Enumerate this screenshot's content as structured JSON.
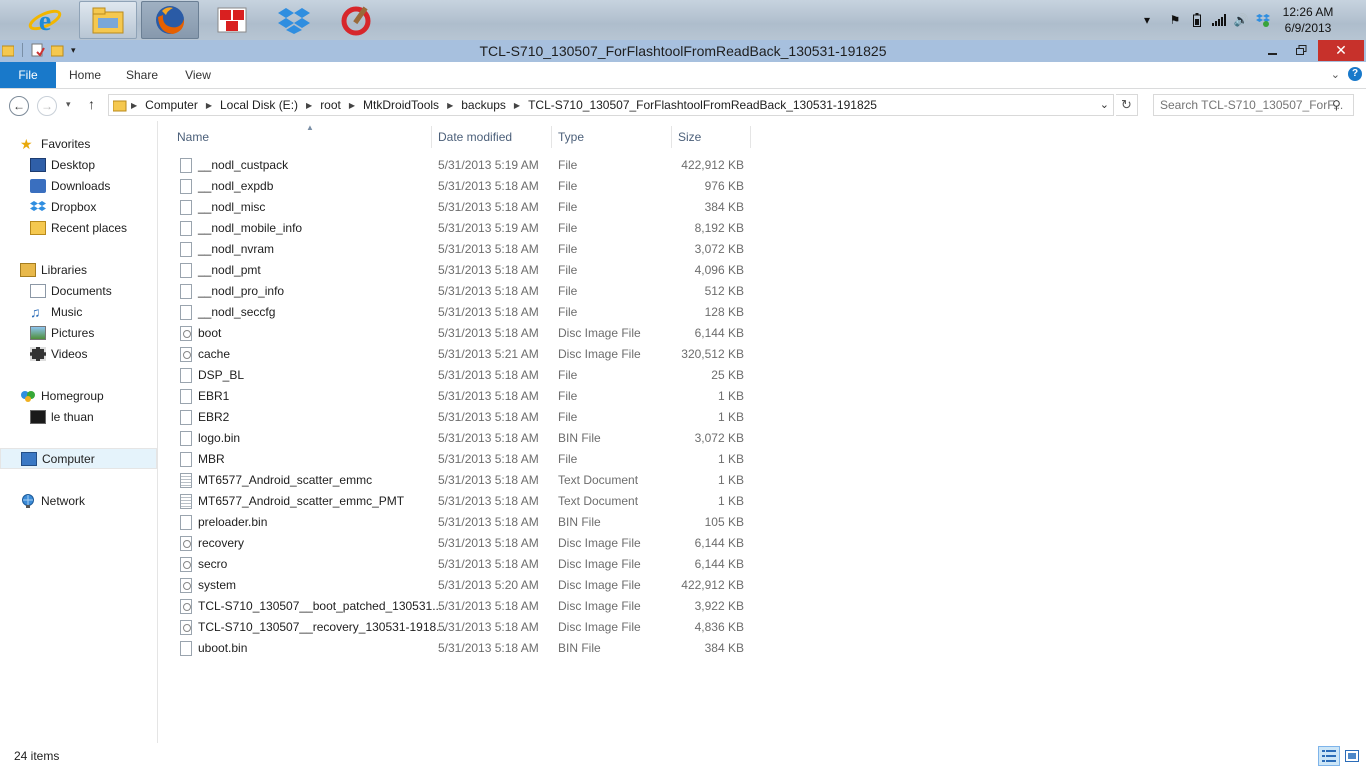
{
  "taskbar": {
    "apps": [
      {
        "name": "internet-explorer",
        "state": "normal"
      },
      {
        "name": "file-explorer",
        "state": "active"
      },
      {
        "name": "firefox",
        "state": "pressed"
      },
      {
        "name": "unikey",
        "state": "normal"
      },
      {
        "name": "dropbox",
        "state": "normal"
      },
      {
        "name": "ccleaner",
        "state": "normal"
      }
    ],
    "clock_time": "12:26 AM",
    "clock_date": "6/9/2013"
  },
  "window": {
    "title": "TCL-S710_130507_ForFlashtoolFromReadBack_130531-191825"
  },
  "ribbon": {
    "tabs": [
      "File",
      "Home",
      "Share",
      "View"
    ]
  },
  "address": {
    "crumbs": [
      "Computer",
      "Local Disk (E:)",
      "root",
      "MtkDroidTools",
      "backups",
      "TCL-S710_130507_ForFlashtoolFromReadBack_130531-191825"
    ],
    "search_placeholder": "Search TCL-S710_130507_ForF..."
  },
  "navpane": {
    "favorites": "Favorites",
    "fav_items": [
      "Desktop",
      "Downloads",
      "Dropbox",
      "Recent places"
    ],
    "libraries": "Libraries",
    "lib_items": [
      "Documents",
      "Music",
      "Pictures",
      "Videos"
    ],
    "homegroup": "Homegroup",
    "home_items": [
      "le thuan"
    ],
    "computer": "Computer",
    "network": "Network"
  },
  "columns": {
    "name": "Name",
    "date": "Date modified",
    "type": "Type",
    "size": "Size"
  },
  "files": [
    {
      "name": "__nodl_custpack",
      "date": "5/31/2013 5:19 AM",
      "type": "File",
      "size": "422,912 KB",
      "icon": "file"
    },
    {
      "name": "__nodl_expdb",
      "date": "5/31/2013 5:18 AM",
      "type": "File",
      "size": "976 KB",
      "icon": "file"
    },
    {
      "name": "__nodl_misc",
      "date": "5/31/2013 5:18 AM",
      "type": "File",
      "size": "384 KB",
      "icon": "file"
    },
    {
      "name": "__nodl_mobile_info",
      "date": "5/31/2013 5:19 AM",
      "type": "File",
      "size": "8,192 KB",
      "icon": "file"
    },
    {
      "name": "__nodl_nvram",
      "date": "5/31/2013 5:18 AM",
      "type": "File",
      "size": "3,072 KB",
      "icon": "file"
    },
    {
      "name": "__nodl_pmt",
      "date": "5/31/2013 5:18 AM",
      "type": "File",
      "size": "4,096 KB",
      "icon": "file"
    },
    {
      "name": "__nodl_pro_info",
      "date": "5/31/2013 5:18 AM",
      "type": "File",
      "size": "512 KB",
      "icon": "file"
    },
    {
      "name": "__nodl_seccfg",
      "date": "5/31/2013 5:18 AM",
      "type": "File",
      "size": "128 KB",
      "icon": "file"
    },
    {
      "name": "boot",
      "date": "5/31/2013 5:18 AM",
      "type": "Disc Image File",
      "size": "6,144 KB",
      "icon": "disc"
    },
    {
      "name": "cache",
      "date": "5/31/2013 5:21 AM",
      "type": "Disc Image File",
      "size": "320,512 KB",
      "icon": "disc"
    },
    {
      "name": "DSP_BL",
      "date": "5/31/2013 5:18 AM",
      "type": "File",
      "size": "25 KB",
      "icon": "file"
    },
    {
      "name": "EBR1",
      "date": "5/31/2013 5:18 AM",
      "type": "File",
      "size": "1 KB",
      "icon": "file"
    },
    {
      "name": "EBR2",
      "date": "5/31/2013 5:18 AM",
      "type": "File",
      "size": "1 KB",
      "icon": "file"
    },
    {
      "name": "logo.bin",
      "date": "5/31/2013 5:18 AM",
      "type": "BIN File",
      "size": "3,072 KB",
      "icon": "file"
    },
    {
      "name": "MBR",
      "date": "5/31/2013 5:18 AM",
      "type": "File",
      "size": "1 KB",
      "icon": "file"
    },
    {
      "name": "MT6577_Android_scatter_emmc",
      "date": "5/31/2013 5:18 AM",
      "type": "Text Document",
      "size": "1 KB",
      "icon": "txt"
    },
    {
      "name": "MT6577_Android_scatter_emmc_PMT",
      "date": "5/31/2013 5:18 AM",
      "type": "Text Document",
      "size": "1 KB",
      "icon": "txt"
    },
    {
      "name": "preloader.bin",
      "date": "5/31/2013 5:18 AM",
      "type": "BIN File",
      "size": "105 KB",
      "icon": "file"
    },
    {
      "name": "recovery",
      "date": "5/31/2013 5:18 AM",
      "type": "Disc Image File",
      "size": "6,144 KB",
      "icon": "disc"
    },
    {
      "name": "secro",
      "date": "5/31/2013 5:18 AM",
      "type": "Disc Image File",
      "size": "6,144 KB",
      "icon": "disc"
    },
    {
      "name": "system",
      "date": "5/31/2013 5:20 AM",
      "type": "Disc Image File",
      "size": "422,912 KB",
      "icon": "disc"
    },
    {
      "name": "TCL-S710_130507__boot_patched_130531...",
      "date": "5/31/2013 5:18 AM",
      "type": "Disc Image File",
      "size": "3,922 KB",
      "icon": "disc"
    },
    {
      "name": "TCL-S710_130507__recovery_130531-1918...",
      "date": "5/31/2013 5:18 AM",
      "type": "Disc Image File",
      "size": "4,836 KB",
      "icon": "disc"
    },
    {
      "name": "uboot.bin",
      "date": "5/31/2013 5:18 AM",
      "type": "BIN File",
      "size": "384 KB",
      "icon": "file"
    }
  ],
  "status": {
    "count": "24 items"
  },
  "colors": {
    "file_tab": "#1979ca",
    "titlebar": "#a7c0de",
    "close": "#c7312b",
    "selected_nav": "#e5f3fb"
  }
}
